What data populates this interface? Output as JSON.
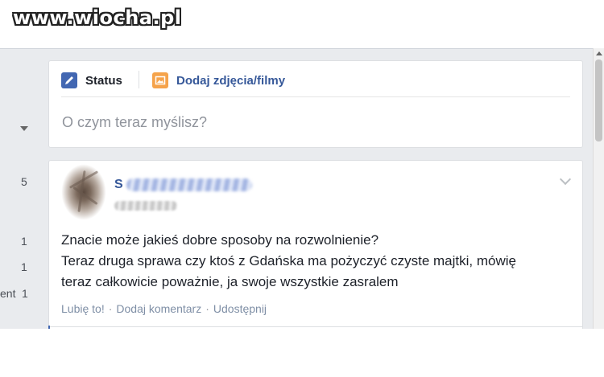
{
  "watermark": {
    "text": "www.wiocha.pl"
  },
  "sidebar": {
    "counts": [
      "5",
      "1",
      "1",
      "1"
    ],
    "partial_label": "ent"
  },
  "composer": {
    "tabs": [
      {
        "label": "Status",
        "icon": "pencil-icon"
      },
      {
        "label": "Dodaj zdjęcia/filmy",
        "icon": "photo-icon"
      }
    ],
    "placeholder": "O czym teraz myślisz?"
  },
  "post": {
    "author_initial": "S",
    "text_lines": [
      "Znacie może jakieś dobre sposoby na rozwolnienie?",
      "Teraz druga sprawa czy ktoś z Gdańska ma pożyczyć czyste majtki, mówię",
      "teraz całkowicie poważnie, ja swoje wszystkie zasralem"
    ],
    "actions": [
      "Lubię to!",
      "Dodaj komentarz",
      "Udostępnij"
    ],
    "separator": "·"
  },
  "colors": {
    "fb_blue": "#4267b2",
    "link_blue": "#365899",
    "background": "#e9ebee",
    "photo_icon": "#f5a34b"
  }
}
